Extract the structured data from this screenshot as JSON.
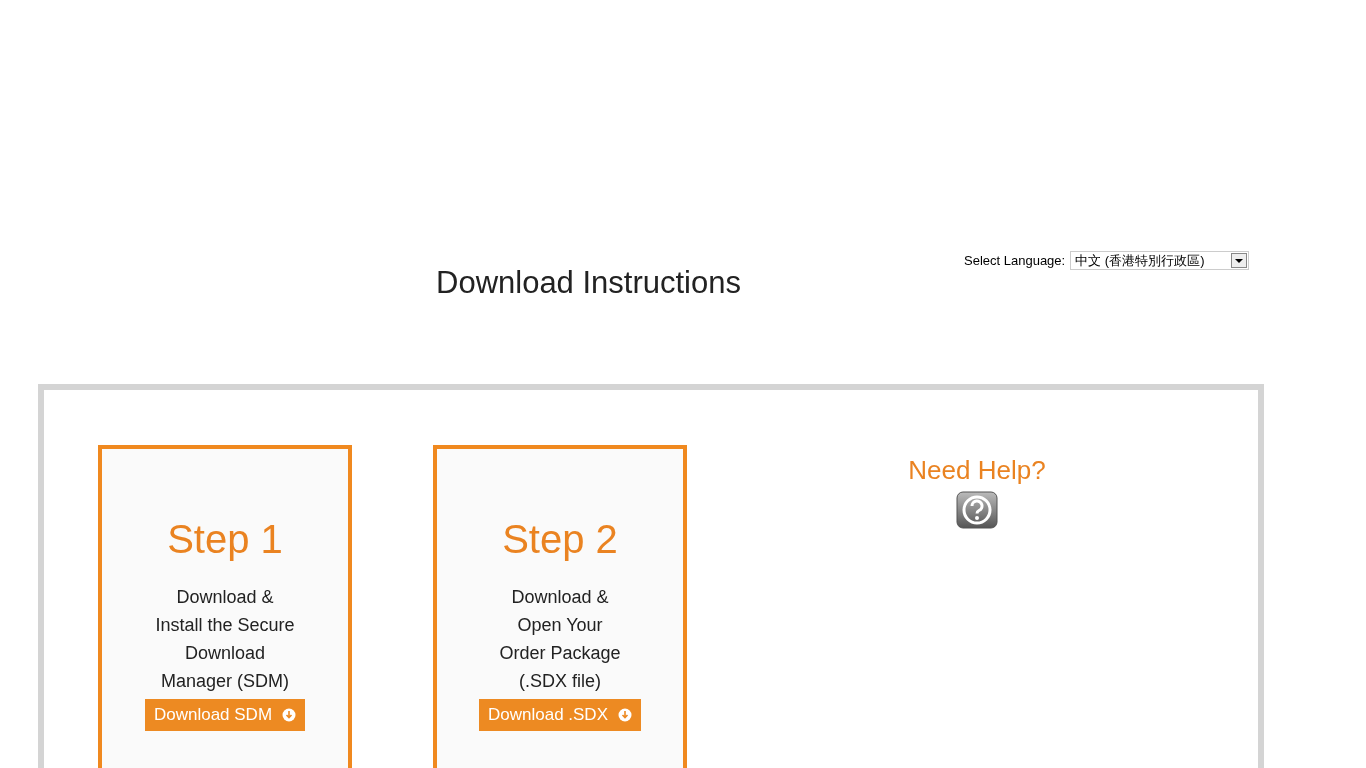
{
  "title": "Download Instructions",
  "language": {
    "label": "Select Language:",
    "value": "中文 (香港特別行政區)"
  },
  "steps": [
    {
      "heading": "Step 1",
      "lines": [
        "Download &",
        "Install the Secure",
        "Download",
        "Manager (SDM)"
      ],
      "button": "Download SDM"
    },
    {
      "heading": "Step 2",
      "lines": [
        "Download &",
        "Open Your",
        "Order Package",
        "(.SDX file)"
      ],
      "button": "Download .SDX"
    }
  ],
  "help": {
    "label": "Need Help?"
  }
}
